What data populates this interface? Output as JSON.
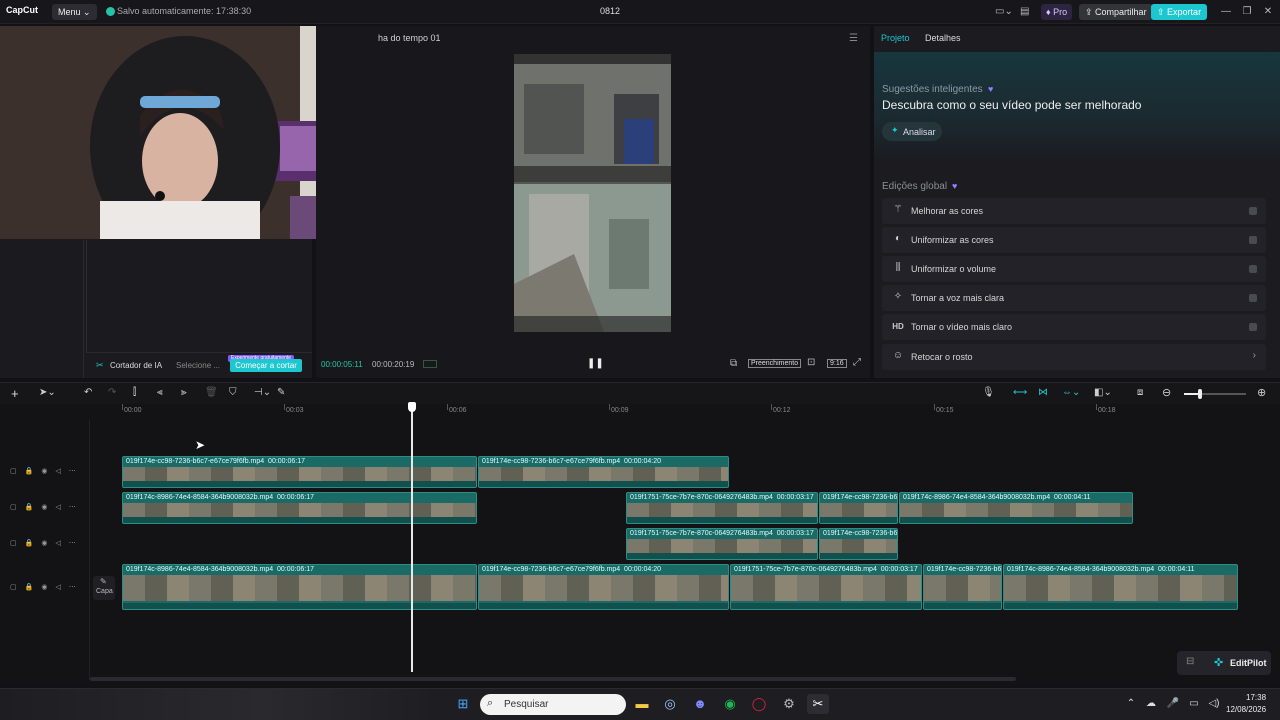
{
  "titlebar": {
    "logo": "CapCut",
    "menu_label": "Menu",
    "autosave": "Salvo automaticamente: 17:38:30",
    "project_name": "0812",
    "pro_label": "Pro",
    "share_label": "Compartilhar",
    "export_label": "Exportar"
  },
  "left": {
    "ai_cutter_label": "Cortador de IA",
    "select_label": "Selecione ...",
    "trial_badge": "Experimente gratuitamente",
    "start_cut_label": "Começar a cortar"
  },
  "preview": {
    "timeline_name": "ha do tempo 01",
    "time_current": "00:00:05:11",
    "time_total": "00:00:20:19",
    "fill_label": "Preenchimento",
    "ratio_label": "9:16"
  },
  "right": {
    "tab_project": "Projeto",
    "tab_details": "Detalhes",
    "smart_suggestions_title": "Sugestões inteligentes",
    "smart_suggestions_desc": "Descubra como o seu vídeo pode ser melhorado",
    "analyze_label": "Analisar",
    "global_edits_title": "Edições global",
    "items": [
      {
        "label": "Melhorar as cores",
        "icon": "wand-icon"
      },
      {
        "label": "Uniformizar as cores",
        "icon": "palette-icon"
      },
      {
        "label": "Uniformizar o volume",
        "icon": "sliders-icon"
      },
      {
        "label": "Tornar a voz mais clara",
        "icon": "sparkle-icon"
      },
      {
        "label": "Tornar o vídeo mais claro",
        "icon": "hd-icon"
      },
      {
        "label": "Retocar o rosto",
        "icon": "face-icon"
      }
    ]
  },
  "timeline": {
    "ticks": [
      "00:00",
      "00:03",
      "00:06",
      "00:09",
      "00:12",
      "00:15",
      "00:18"
    ],
    "cover_label": "Capa",
    "clips": [
      {
        "track": 0,
        "name": "019f174e-cc98-7236-b6c7-e67ce79f6fb.mp4",
        "duration": "00:00:06:17"
      },
      {
        "track": 0,
        "name": "019f174e-cc98-7236-b6c7-e67ce79f6fb.mp4",
        "duration": "00:00:04:20"
      },
      {
        "track": 1,
        "name": "019f174c-8986-74e4-8584-364b9008032b.mp4",
        "duration": "00:00:06:17"
      },
      {
        "track": 1,
        "name": "019f1751-75ce-7b7e-870c-0649276483b.mp4",
        "duration": "00:00:03:17"
      },
      {
        "track": 1,
        "name": "019f174e-cc98-7236-b6",
        "duration": ""
      },
      {
        "track": 1,
        "name": "019f174c-8986-74e4-8584-364b9008032b.mp4",
        "duration": "00:00:04:11"
      },
      {
        "track": 2,
        "name": "019f1751-75ce-7b7e-870c-0649276483b.mp4",
        "duration": "00:00:03:17"
      },
      {
        "track": 2,
        "name": "019f174e-cc98-7236-b6",
        "duration": ""
      },
      {
        "track": 3,
        "name": "019f174c-8986-74e4-8584-364b9008032b.mp4",
        "duration": "00:00:06:17"
      },
      {
        "track": 3,
        "name": "019f174e-cc98-7236-b6c7-e67ce79f6fb.mp4",
        "duration": "00:00:04:20"
      },
      {
        "track": 3,
        "name": "019f1751-75ce-7b7e-870c-0649276483b.mp4",
        "duration": "00:00:03:17"
      },
      {
        "track": 3,
        "name": "019f174e-cc98-7236-b6",
        "duration": ""
      },
      {
        "track": 3,
        "name": "019f174c-8986-74e4-8584-364b9008032b.mp4",
        "duration": "00:00:04:11"
      }
    ],
    "editpilot_label": "EditPilot"
  },
  "taskbar": {
    "search_placeholder": "Pesquisar",
    "time": "17:38",
    "date": "12/08/2026"
  },
  "colors": {
    "accent": "#1cc7d0",
    "clip": "#1a6a66",
    "autosave_dot": "#23c4a6"
  }
}
